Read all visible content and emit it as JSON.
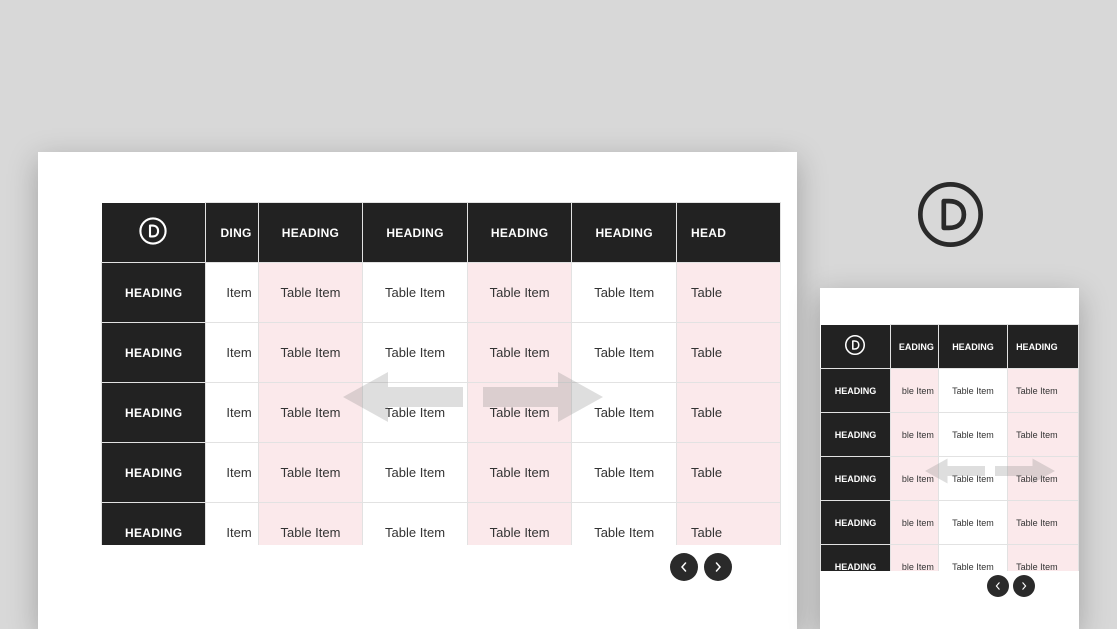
{
  "logo_label": "divi-logo",
  "table": {
    "header_icon": "divi-logo-icon",
    "col_header": "HEADING",
    "row_header": "HEADING",
    "cell_value": "Table Item",
    "partial_header": "HEADING",
    "partial_header_clip_desktop": "DING",
    "partial_header_clip_mobile": "EADING",
    "partial_cell_clip_desktop": "Item",
    "partial_cell_clip_mobile": "ble Item",
    "partial_right_header_clip": "HEAD",
    "partial_right_cell_clip": "Table",
    "partial_right_cell_clip_mobile": "Table Item"
  },
  "nav": {
    "prev": "previous",
    "next": "next"
  }
}
